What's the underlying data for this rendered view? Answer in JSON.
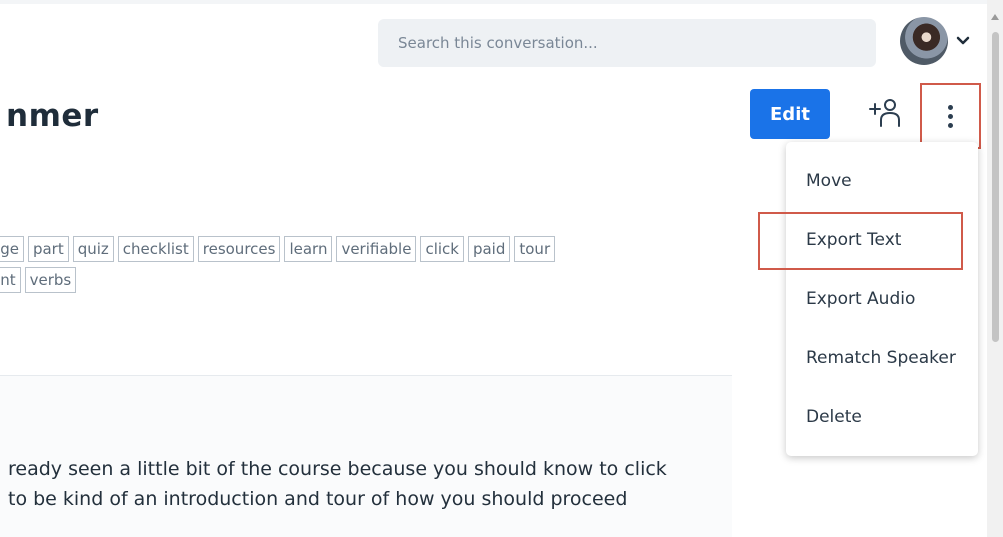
{
  "header": {
    "search": {
      "placeholder": "Search this conversation..."
    },
    "avatar": {
      "icon": "user-avatar"
    }
  },
  "conversation": {
    "title": "nmer",
    "edit_label": "Edit",
    "tags": [
      [
        "age",
        "part",
        "quiz",
        "checklist",
        "resources",
        "learn",
        "verifiable",
        "click",
        "paid",
        "tour"
      ],
      [
        "ant",
        "verbs"
      ]
    ],
    "transcript_lines": [
      "ready seen a little bit of the course because you should know to click",
      "to be kind of an introduction and tour of how you should proceed"
    ]
  },
  "menu": {
    "items": [
      "Move",
      "Export Text",
      "Export Audio",
      "Rematch Speaker",
      "Delete"
    ]
  },
  "colors": {
    "accent": "#1a73e8",
    "highlight_outline": "#d05a4a"
  }
}
